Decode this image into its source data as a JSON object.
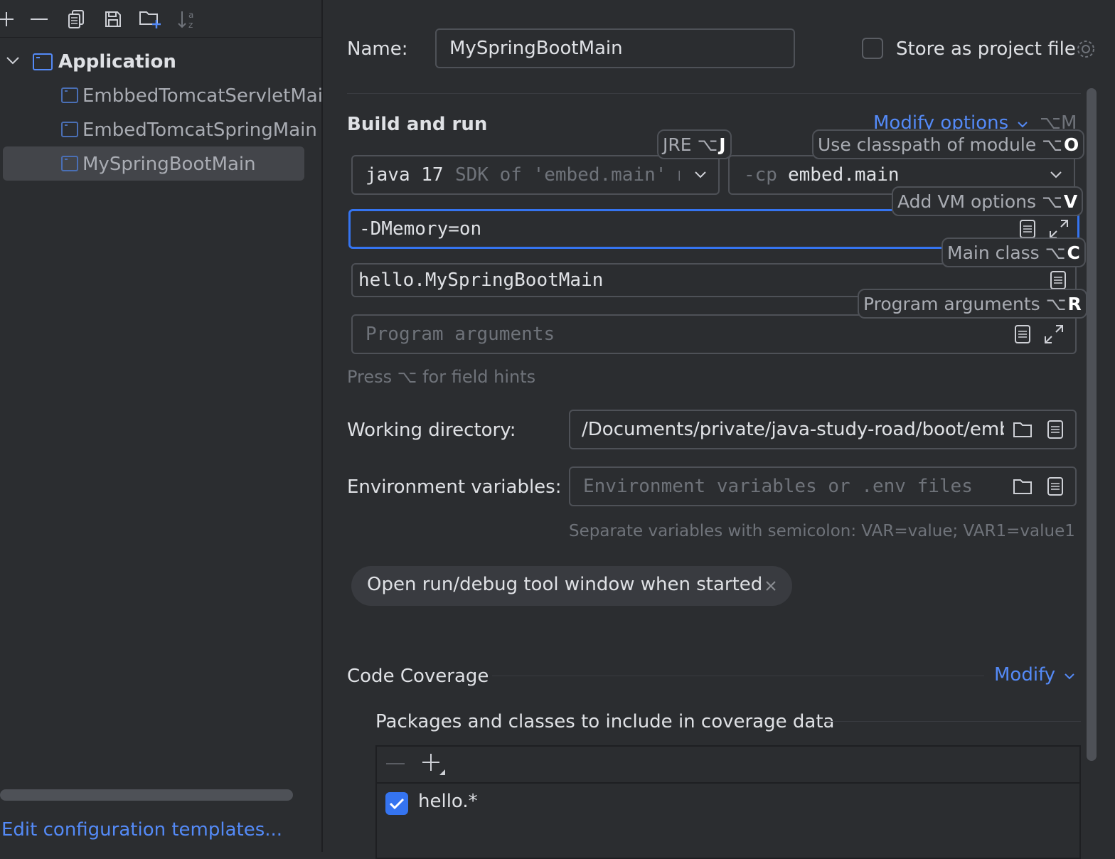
{
  "left_panel": {
    "tree": {
      "group_label": "Application",
      "items": [
        {
          "label": "EmbbedTomcatServletMain"
        },
        {
          "label": "EmbedTomcatSpringMain"
        },
        {
          "label": "MySpringBootMain"
        }
      ]
    },
    "footer_link": "Edit configuration templates..."
  },
  "header": {
    "name_label": "Name:",
    "name_value": "MySpringBootMain",
    "store_label": "Store as project file"
  },
  "build_run": {
    "title": "Build and run",
    "modify_label": "Modify options",
    "modify_shortcut": "⌥M",
    "jre_value": "java 17",
    "jre_detail": "SDK of 'embed.main' m",
    "cp_prefix": "-cp",
    "cp_value": "embed.main",
    "vm_options_value": "-DMemory=on",
    "main_class_value": "hello.MySpringBootMain",
    "program_args_placeholder": "Program arguments",
    "field_hint_text": "Press ⌥ for field hints"
  },
  "hints": {
    "jre": {
      "text": "JRE ⌥",
      "key": "J"
    },
    "classpath": {
      "text": "Use classpath of module ⌥",
      "key": "O"
    },
    "vm": {
      "text": "Add VM options ⌥",
      "key": "V"
    },
    "main_class": {
      "text": "Main class ⌥",
      "key": "C"
    },
    "program_args": {
      "text": "Program arguments ⌥",
      "key": "R"
    }
  },
  "working_dir": {
    "label": "Working directory:",
    "value": "/Documents/private/java-study-road/boot/embed"
  },
  "env_vars": {
    "label": "Environment variables:",
    "placeholder": "Environment variables or .env files",
    "hint": "Separate variables with semicolon: VAR=value; VAR1=value1"
  },
  "option_chip": {
    "label": "Open run/debug tool window when started"
  },
  "coverage": {
    "title": "Code Coverage",
    "modify_label": "Modify",
    "packages_title": "Packages and classes to include in coverage data",
    "rows": [
      {
        "pattern": "hello.*",
        "checked": true
      }
    ]
  },
  "colors": {
    "background": "#2b2d30",
    "accent": "#3574f0",
    "link": "#548af7",
    "text": "#dfe1e5",
    "muted": "#6f737a"
  }
}
